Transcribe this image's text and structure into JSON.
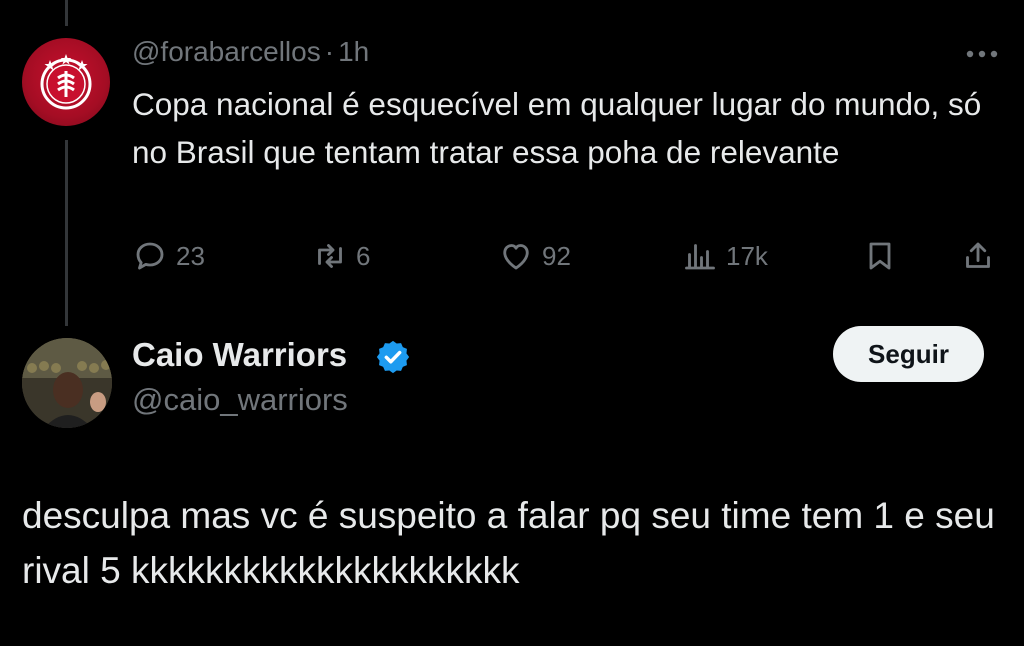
{
  "parent_tweet": {
    "handle": "@forabarcellos",
    "separator": "·",
    "time": "1h",
    "text": "Copa nacional é esquecível em qualquer lugar do mundo, só no Brasil que tentam tratar essa poha de relevante",
    "stats": {
      "replies": "23",
      "retweets": "6",
      "likes": "92",
      "views": "17k"
    }
  },
  "reply": {
    "name": "Caio Warriors",
    "handle": "@caio_warriors",
    "follow_label": "Seguir",
    "text": "desculpa mas vc é suspeito a falar pq seu time tem 1 e seu rival 5 kkkkkkkkkkkkkkkkkkkkk"
  },
  "colors": {
    "background": "#000000",
    "text": "#e7e9ea",
    "secondary": "#71767b",
    "verified": "#1d9bf0",
    "club_red": "#c8102e"
  },
  "icons": [
    "more-icon",
    "reply-icon",
    "retweet-icon",
    "like-icon",
    "views-icon",
    "bookmark-icon",
    "share-icon",
    "verified-icon"
  ]
}
